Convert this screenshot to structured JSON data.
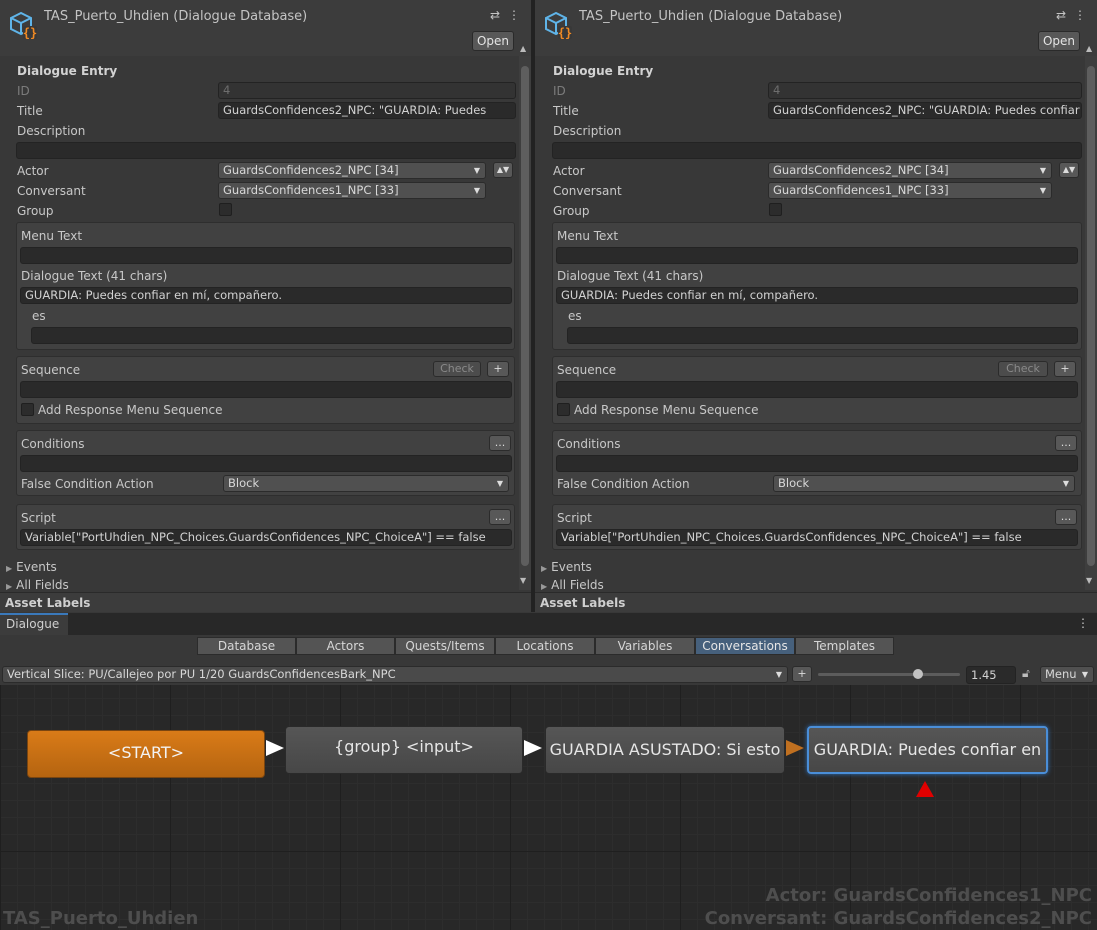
{
  "left_inspector": {
    "title": "TAS_Puerto_Uhdien (Dialogue Database)",
    "open_label": "Open",
    "section_title": "Dialogue Entry",
    "id_label": "ID",
    "id_value": "4",
    "title_label": "Title",
    "title_value": "GuardsConfidences2_NPC: \"GUARDIA: Puedes",
    "description_label": "Description",
    "description_value": "",
    "actor_label": "Actor",
    "actor_value": "GuardsConfidences2_NPC [34]",
    "conversant_label": "Conversant",
    "conversant_value": "GuardsConfidences1_NPC [33]",
    "group_label": "Group",
    "menu_text_label": "Menu Text",
    "menu_text_value": "",
    "dialogue_text_label": "Dialogue Text (41 chars)",
    "dialogue_text_value": "GUARDIA: Puedes confiar en mí, compañero.",
    "localization_label": "es",
    "localization_value": "",
    "sequence_label": "Sequence",
    "check_label": "Check",
    "plus_label": "+",
    "sequence_value": "",
    "add_response_label": "Add Response Menu Sequence",
    "conditions_label": "Conditions",
    "ellipsis_label": "...",
    "conditions_value": "",
    "false_condition_label": "False Condition Action",
    "false_condition_value": "Block",
    "script_label": "Script",
    "script_value": "Variable[\"PortUhdien_NPC_Choices.GuardsConfidences_NPC_ChoiceA\"] == false",
    "events_label": "Events",
    "all_fields_label": "All Fields",
    "asset_labels": "Asset Labels"
  },
  "right_inspector": {
    "title": "TAS_Puerto_Uhdien (Dialogue Database)",
    "open_label": "Open",
    "section_title": "Dialogue Entry",
    "id_label": "ID",
    "id_value": "4",
    "title_label": "Title",
    "title_value": "GuardsConfidences2_NPC: \"GUARDIA: Puedes confiar",
    "description_label": "Description",
    "description_value": "",
    "actor_label": "Actor",
    "actor_value": "GuardsConfidences2_NPC [34]",
    "conversant_label": "Conversant",
    "conversant_value": "GuardsConfidences1_NPC [33]",
    "group_label": "Group",
    "menu_text_label": "Menu Text",
    "menu_text_value": "",
    "dialogue_text_label": "Dialogue Text (41 chars)",
    "dialogue_text_value": "GUARDIA: Puedes confiar en mí, compañero.",
    "localization_label": "es",
    "localization_value": "",
    "sequence_label": "Sequence",
    "check_label": "Check",
    "plus_label": "+",
    "sequence_value": "",
    "add_response_label": "Add Response Menu Sequence",
    "conditions_label": "Conditions",
    "ellipsis_label": "...",
    "conditions_value": "",
    "false_condition_label": "False Condition Action",
    "false_condition_value": "Block",
    "script_label": "Script",
    "script_value": "Variable[\"PortUhdien_NPC_Choices.GuardsConfidences_NPC_ChoiceA\"] == false",
    "events_label": "Events",
    "all_fields_label": "All Fields",
    "asset_labels": "Asset Labels"
  },
  "dialogue_editor": {
    "window_tab": "Dialogue",
    "tabs": [
      "Database",
      "Actors",
      "Quests/Items",
      "Locations",
      "Variables",
      "Conversations",
      "Templates"
    ],
    "active_tab": "Conversations",
    "conversation_select": "Vertical Slice: PU/Callejeo por PU 1/20 GuardsConfidencesBark_NPC",
    "add_label": "+",
    "zoom_value": "1.45",
    "menu_label": "Menu",
    "nodes": {
      "start": "<START>",
      "group": "{group} <input>",
      "guardia_asustado": "GUARDIA ASUSTADO: Si esto",
      "guardia_confiar": "GUARDIA: Puedes confiar en"
    },
    "overlay": {
      "actor": "Actor: GuardsConfidences1_NPC",
      "conversant": "Conversant: GuardsConfidences2_NPC",
      "database": "TAS_Puerto_Uhdien"
    }
  },
  "colors": {
    "start_node": "#c86e14",
    "selected_outline": "#4a8ed8",
    "active_tab": "#46607c",
    "marker_red": "#e00000"
  },
  "icons": {
    "logo": "dialogue-database-cube-icon",
    "sliders": "sliders-icon",
    "more": "kebab-menu-icon",
    "lock": "lock-icon"
  }
}
